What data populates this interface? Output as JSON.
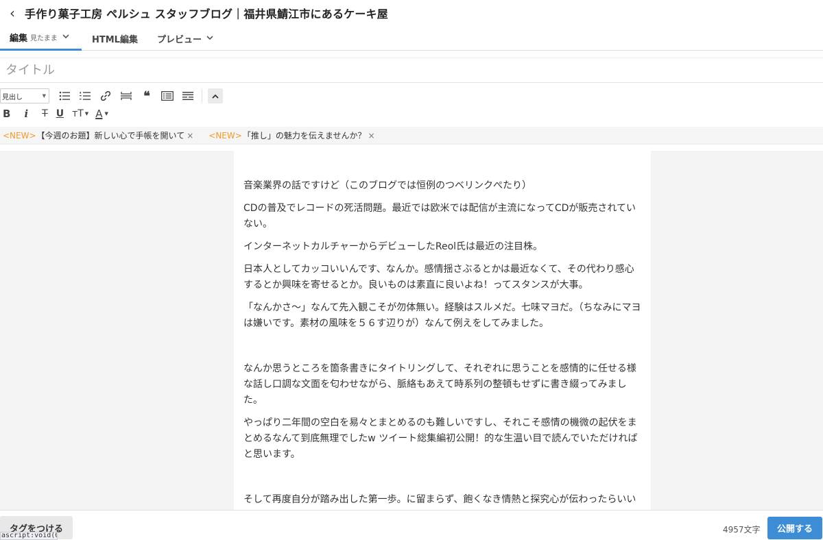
{
  "header": {
    "back_glyph": "‹",
    "blog_title": "手作り菓子工房 ペルシュ スタッフブログ｜福井県鯖江市にあるケーキ屋"
  },
  "tabs": [
    {
      "label": "編集",
      "sub": "見たまま",
      "active": true,
      "has_dropdown": true
    },
    {
      "label": "HTML編集",
      "active": false,
      "has_dropdown": false
    },
    {
      "label": "プレビュー",
      "active": false,
      "has_dropdown": true
    }
  ],
  "title_field": {
    "value": "",
    "placeholder": "タイトル"
  },
  "toolbar": {
    "heading_select_value": "見出し",
    "row1_icons": [
      "bulleted-list-icon",
      "numbered-list-icon",
      "link-icon",
      "horizontal-rule-icon",
      "quote-icon",
      "table-of-contents-icon",
      "read-more-icon"
    ],
    "row2_labels": {
      "bold": "B",
      "italic": "i",
      "strike": "T",
      "underline": "U",
      "font_size": "тT",
      "font_color": "A"
    }
  },
  "announcements": [
    {
      "badge": "<NEW>",
      "text": "【今週のお題】新しい心で手帳を開いて",
      "close": "×"
    },
    {
      "badge": "<NEW>",
      "text": "「推し」の魅力を伝えませんか？",
      "close": "×"
    }
  ],
  "editor": {
    "paragraphs": [
      "音楽業界の話ですけど（このブログでは恒例のつベリンクぺたり）",
      "CDの普及でレコードの死活問題。最近では欧米では配信が主流になってCDが販売されていない。",
      "インターネットカルチャーからデビューしたReol氏は最近の注目株。",
      "日本人としてカッコいいんです、なんか。感情揺さぶるとかは最近なくて、その代わり感心するとか興味を寄せるとか。良いものは素直に良いよね！ってスタンスが大事。",
      "「なんかさ〜」なんて先入観こそが勿体無い。経験はスルメだ。七味マヨだ。（ちなみにマヨは嫌いです。素材の風味を５６す辺りが）なんて例えをしてみました。",
      "",
      "なんか思うところを箇条書きにタイトリングして、それぞれに思うことを感情的に任せる様な話し口調な文面を匂わせながら、脈絡もあえて時系列の整頓もせずに書き綴ってみました。",
      "やっぱり二年間の空白を易々とまとめるのも難しいですし、それこそ感情の機微の起伏をまとめるなんて到底無理でしたw ツイート総集編初公開！的な生温い目で読んでいただければと思います。",
      "",
      "そして再度自分が踏み出した第一歩。に留まらず、飽くなき情熱と探究心が伝わったらいいな。とつらつらもうすぐ5000文字到達の長々ダラダラにお付き合いいただきありがとうございました"
    ]
  },
  "footer": {
    "tag_button": "タグをつける",
    "char_count": "4957文字",
    "publish_button": "公開する",
    "status_text": "ascript:void(0)"
  },
  "colors": {
    "accent": "#3d8cd6",
    "new_badge": "#f09a28",
    "editor_bg": "#f4f4f4"
  }
}
